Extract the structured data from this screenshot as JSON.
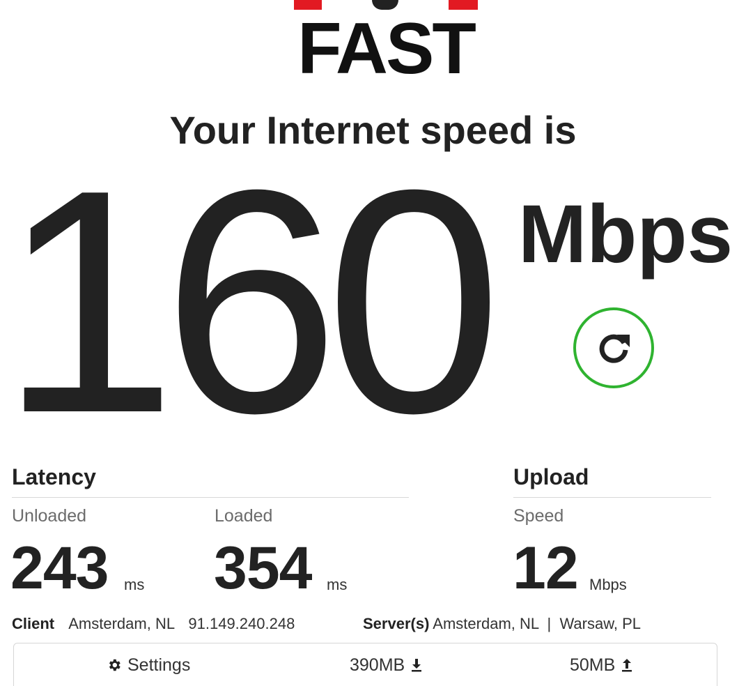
{
  "logo": {
    "text": "FAST",
    "accent_color": "#e21a22"
  },
  "heading": "Your Internet speed is",
  "speed": {
    "value": "160",
    "units": "Mbps"
  },
  "refresh": {
    "icon": "refresh-icon",
    "color": "#2fb330"
  },
  "latency": {
    "title": "Latency",
    "unloaded": {
      "label": "Unloaded",
      "value": "243",
      "unit": "ms"
    },
    "loaded": {
      "label": "Loaded",
      "value": "354",
      "unit": "ms"
    }
  },
  "upload": {
    "title": "Upload",
    "speed": {
      "label": "Speed",
      "value": "12",
      "unit": "Mbps"
    }
  },
  "client": {
    "label": "Client",
    "location": "Amsterdam, NL",
    "ip": "91.149.240.248"
  },
  "servers": {
    "label": "Server(s)",
    "list": "Amsterdam, NL  |  Warsaw, PL"
  },
  "settings_bar": {
    "settings_label": "Settings",
    "download_amount": "390MB",
    "upload_amount": "50MB"
  }
}
